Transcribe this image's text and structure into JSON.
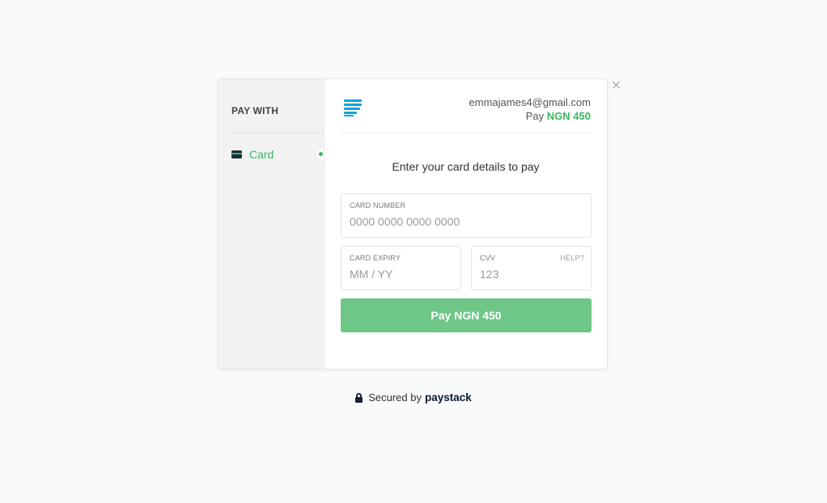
{
  "sidebar": {
    "title": "PAY WITH",
    "items": [
      {
        "label": "Card",
        "icon": "credit-card-icon",
        "active": true
      }
    ]
  },
  "header": {
    "email": "emmajames4@gmail.com",
    "pay_prefix": "Pay",
    "amount": "NGN 450"
  },
  "heading": "Enter your card details to pay",
  "form": {
    "card_number": {
      "label": "CARD NUMBER",
      "placeholder": "0000 0000 0000 0000",
      "value": ""
    },
    "card_expiry": {
      "label": "CARD EXPIRY",
      "placeholder": "MM / YY",
      "value": ""
    },
    "cvv": {
      "label": "CVV",
      "placeholder": "123",
      "value": "",
      "help": "HELP?"
    }
  },
  "pay_button": "Pay NGN 450",
  "footer": {
    "secured_text": "Secured by",
    "brand": "paystack"
  },
  "colors": {
    "accent": "#3bb75e",
    "button": "#6ec687",
    "logo": "#0ba4db"
  }
}
